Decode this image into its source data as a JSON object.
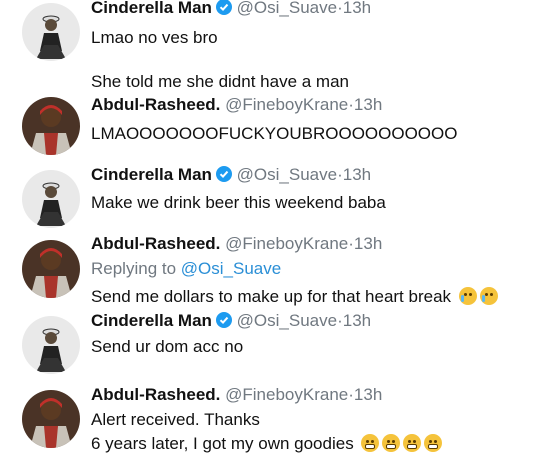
{
  "tweets": [
    {
      "name": "Cinderella Man",
      "verified": true,
      "handle": "@Osi_Suave",
      "time": "13h",
      "avatar": "avatar-cinderella",
      "lines": [
        "Lmao no ves bro",
        "",
        "She told me she didnt have a man"
      ]
    },
    {
      "name": "Abdul-Rasheed.",
      "verified": false,
      "handle": "@FineboyKrane",
      "time": "13h",
      "avatar": "avatar-abdul",
      "lines": [
        "LMAOOOOOOOFUCKYOUBROOOOOOOOOO"
      ]
    },
    {
      "name": "Cinderella Man",
      "verified": true,
      "handle": "@Osi_Suave",
      "time": "13h",
      "avatar": "avatar-cinderella",
      "lines": [
        "Make we drink beer this weekend baba"
      ]
    },
    {
      "name": "Abdul-Rasheed.",
      "verified": false,
      "handle": "@FineboyKrane",
      "time": "13h",
      "avatar": "avatar-abdul",
      "reply_prefix": "Replying to",
      "reply_handle": "@Osi_Suave",
      "lines": [
        "Send me dollars to make up for that heart break"
      ],
      "emojis": [
        "crying-face-emoji",
        "crying-face-emoji"
      ]
    },
    {
      "name": "Cinderella Man",
      "verified": true,
      "handle": "@Osi_Suave",
      "time": "13h",
      "avatar": "avatar-cinderella",
      "lines": [
        "Send ur dom acc no"
      ]
    },
    {
      "name": "Abdul-Rasheed.",
      "verified": false,
      "handle": "@FineboyKrane",
      "time": "13h",
      "avatar": "avatar-abdul",
      "lines": [
        "Alert received. Thanks",
        "6 years later, I got my own goodies"
      ],
      "emojis": [
        "grinning-face-emoji",
        "grinning-face-emoji",
        "grinning-face-emoji",
        "grinning-face-emoji"
      ]
    }
  ],
  "separator": "·",
  "colors": {
    "handle": "#707880",
    "link": "#2b8fd6",
    "verified": "#1d9bf0"
  }
}
